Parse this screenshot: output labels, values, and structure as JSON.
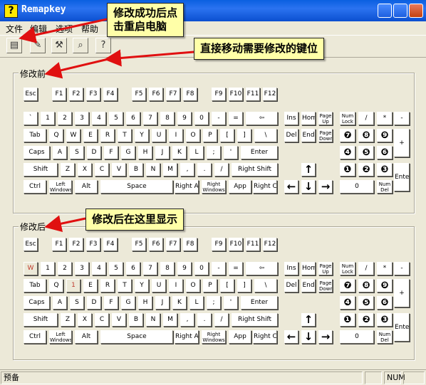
{
  "window": {
    "title": "Remapkey"
  },
  "menu": [
    "文件",
    "编辑",
    "选项",
    "帮助"
  ],
  "toolbar": {
    "buttons": [
      {
        "name": "save-toolbar-button",
        "icon": "save-keyboard-icon"
      },
      {
        "name": "edit-toolbar-button",
        "icon": "edit-keyboard-icon"
      },
      {
        "name": "reset-toolbar-button",
        "icon": "hammer-icon"
      },
      {
        "name": "view-toolbar-button",
        "icon": "magnifier-icon"
      },
      {
        "name": "help-toolbar-button",
        "icon": "question-icon"
      }
    ]
  },
  "panels": {
    "before_label": "修改前",
    "after_label": "修改后"
  },
  "callouts": {
    "restart": "修改成功后点\n击重启电脑",
    "drag": "直接移动需要修改的键位",
    "display": "修改后在这里显示"
  },
  "status": {
    "text": "预备",
    "indicator": "NUM"
  },
  "remapped_key_label": "W",
  "keys": {
    "Esc": "Esc",
    "F1": "F1",
    "F2": "F2",
    "F3": "F3",
    "F4": "F4",
    "F5": "F5",
    "F6": "F6",
    "F7": "F7",
    "F8": "F8",
    "F9": "F9",
    "F10": "F10",
    "F11": "F11",
    "F12": "F12",
    "grave": "`",
    "1": "1",
    "2": "2",
    "3": "3",
    "4": "4",
    "5": "5",
    "6": "6",
    "7": "7",
    "8": "8",
    "9": "9",
    "0": "0",
    "minus": "-",
    "equal": "=",
    "Back": "⇦",
    "Tab": "Tab",
    "Q": "Q",
    "W": "W",
    "E": "E",
    "R": "R",
    "T": "T",
    "Y": "Y",
    "U": "U",
    "I": "I",
    "O": "O",
    "P": "P",
    "lbr": "[",
    "rbr": "]",
    "bslash": "\\",
    "Caps": "Caps",
    "A": "A",
    "S": "S",
    "D": "D",
    "F": "F",
    "G": "G",
    "H": "H",
    "J": "J",
    "K": "K",
    "L": "L",
    "semi": ";",
    "quote": "'",
    "Enter": "Enter",
    "LShift": "Shift",
    "Z": "Z",
    "X": "X",
    "C": "C",
    "V": "V",
    "B": "B",
    "N": "N",
    "M": "M",
    "comma": ",",
    "period": ".",
    "slash": "/",
    "RShift": "Right Shift",
    "Ctrl": "Ctrl",
    "LWin": "Left\nWindows",
    "Alt": "Alt",
    "Space": "Space",
    "RAlt": "Right Alt",
    "RWin": "Right\nWindows",
    "App": "App",
    "RCtrl": "Right Ctrl",
    "Ins": "Ins",
    "Home": "Home",
    "PgUp": "Page\nUp",
    "Del": "Del",
    "End": "End",
    "PgDn": "Page\nDown",
    "Up": "↑",
    "Left": "←",
    "Down": "↓",
    "Right": "→",
    "NumLock": "Num\nLock",
    "NumDiv": "/",
    "NumMul": "*",
    "NumSub": "-",
    "Num7": "❼",
    "Num8": "❽",
    "Num9": "❾",
    "NumAdd": "+",
    "Num4": "❹",
    "Num5": "❺",
    "Num6": "❻",
    "Num1": "❶",
    "Num2": "❷",
    "Num3": "❸",
    "NumEnter": "Enter",
    "Num0": "0",
    "NumDel": "Num\nDel"
  },
  "remap_after": {
    "grave2": "W",
    "W2": "1"
  }
}
